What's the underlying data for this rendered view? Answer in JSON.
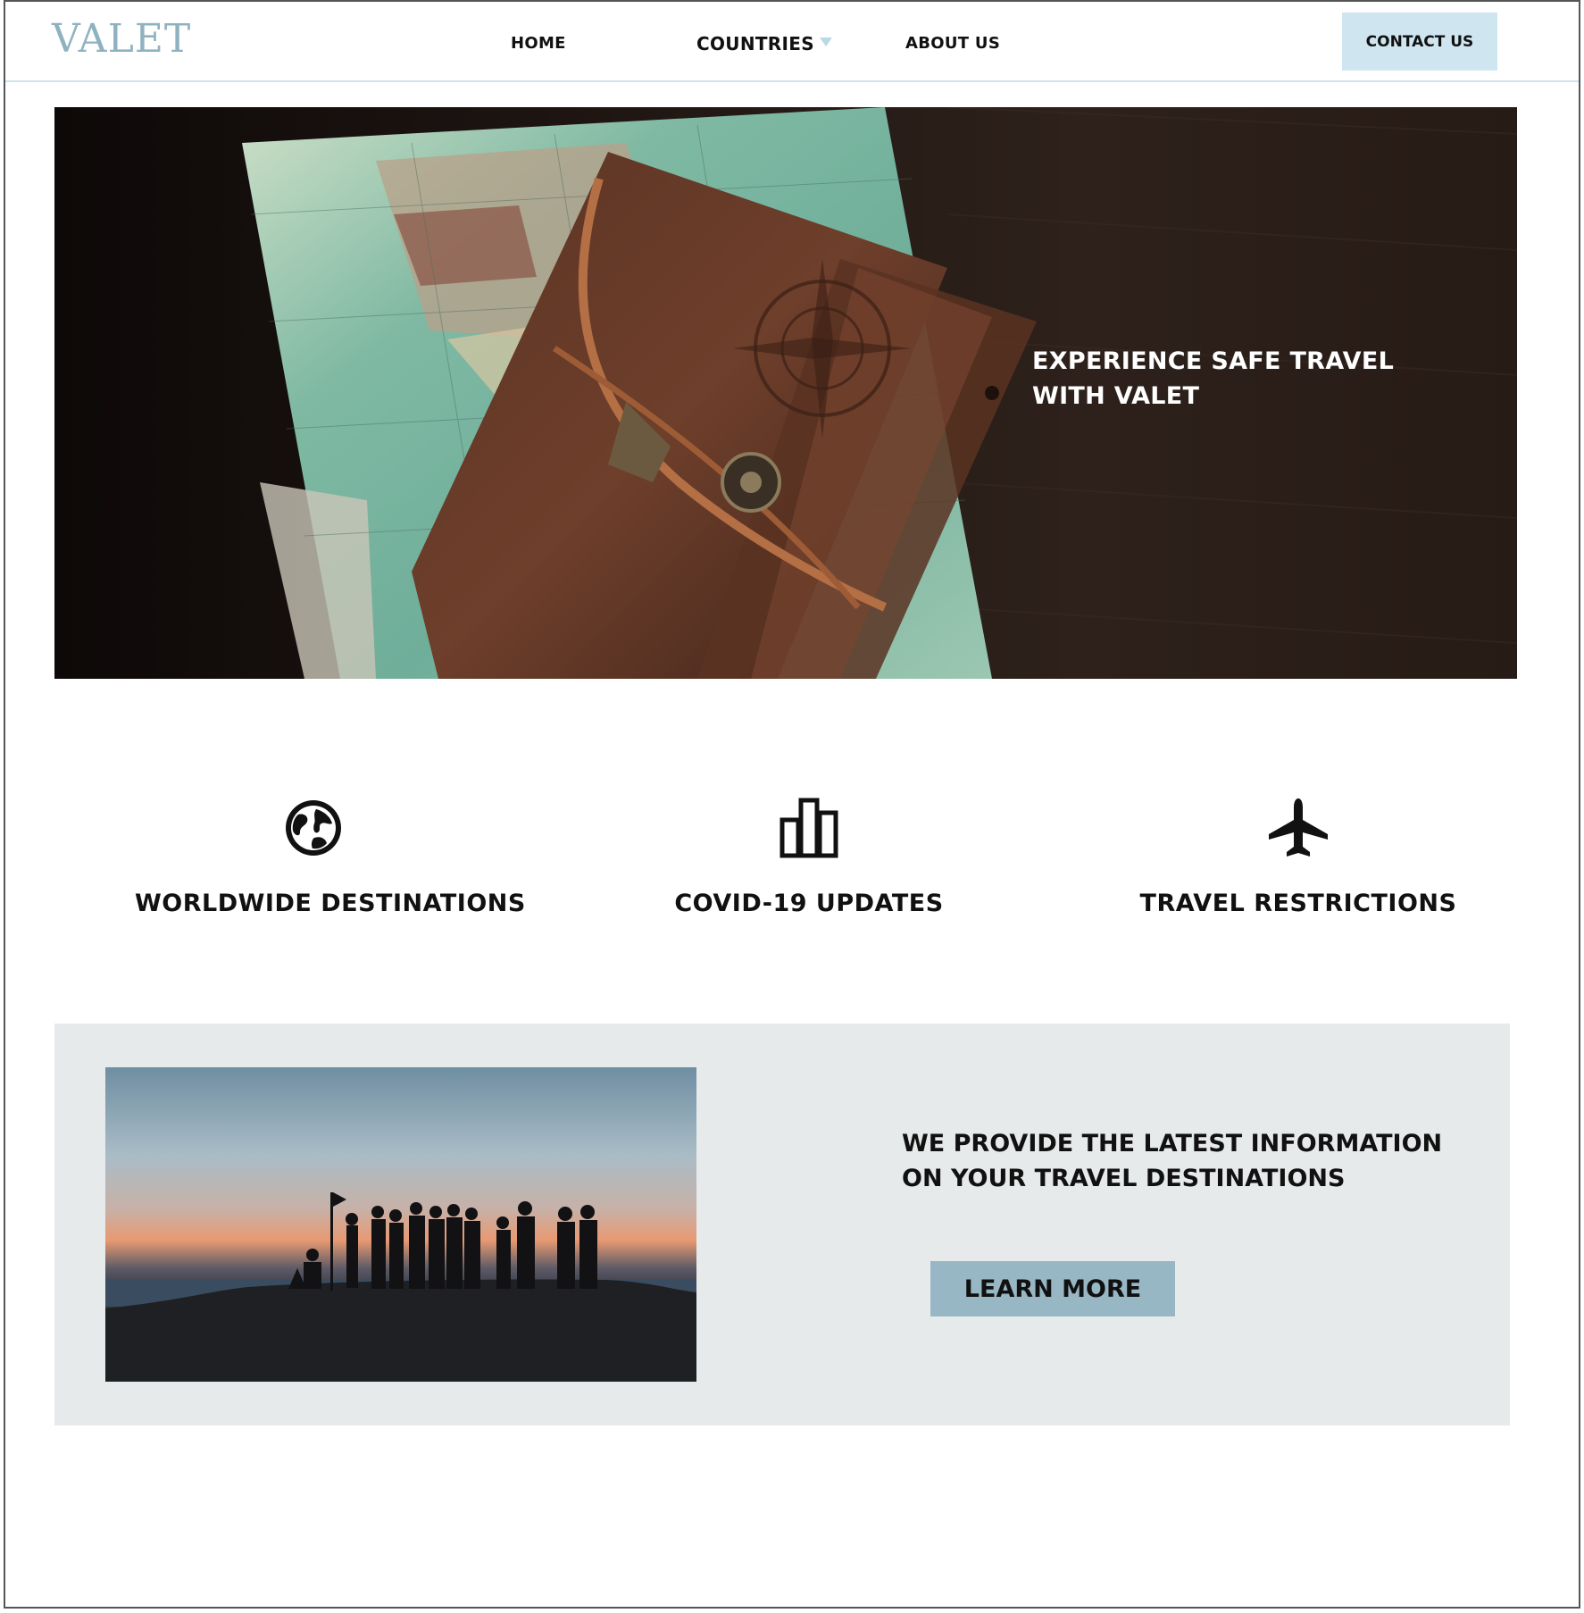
{
  "header": {
    "logo": "VALET",
    "nav": {
      "home": "HOME",
      "countries": "COUNTRIES",
      "about": "ABOUT US"
    },
    "contact_label": "CONTACT US"
  },
  "hero": {
    "headline": "EXPERIENCE SAFE TRAVEL WITH VALET"
  },
  "features": [
    {
      "icon": "globe-icon",
      "label": "WORLDWIDE DESTINATIONS"
    },
    {
      "icon": "bar-chart-icon",
      "label": "COVID-19 UPDATES"
    },
    {
      "icon": "airplane-icon",
      "label": "TRAVEL RESTRICTIONS"
    }
  ],
  "info": {
    "text": "WE PROVIDE THE LATEST INFORMATION ON YOUR TRAVEL DESTINATIONS",
    "button_label": "LEARN MORE"
  },
  "colors": {
    "logo": "#8fb2c0",
    "contact_bg": "#cfe6f1",
    "info_bg": "#e6eaeb",
    "learn_btn_bg": "#98b7c5"
  }
}
